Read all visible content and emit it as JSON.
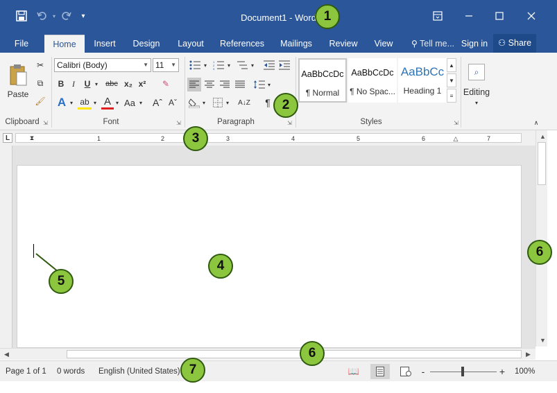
{
  "title": "Document1 - Word",
  "titlebar": {
    "save_icon": "save-icon",
    "undo_icon": "undo-icon",
    "redo_icon": "redo-icon",
    "qat_icon": "customize-quick-access-icon",
    "ribbon_display_icon": "ribbon-display-options-icon",
    "minimize_icon": "minimize-icon",
    "maximize_icon": "maximize-icon",
    "close_icon": "close-icon"
  },
  "tabs": [
    {
      "label": "File"
    },
    {
      "label": "Home"
    },
    {
      "label": "Insert"
    },
    {
      "label": "Design"
    },
    {
      "label": "Layout"
    },
    {
      "label": "References"
    },
    {
      "label": "Mailings"
    },
    {
      "label": "Review"
    },
    {
      "label": "View"
    }
  ],
  "tell_me": "Tell me...",
  "sign_in": "Sign in",
  "share": "Share",
  "ribbon": {
    "clipboard": {
      "paste": "Paste",
      "label": "Clipboard"
    },
    "font": {
      "name": "Calibri (Body)",
      "size": "11",
      "change_case": "Aa",
      "label": "Font"
    },
    "paragraph": {
      "label": "Paragraph"
    },
    "styles": {
      "items": [
        {
          "preview": "AaBbCcDc",
          "name": "¶ Normal"
        },
        {
          "preview": "AaBbCcDc",
          "name": "¶ No Spac..."
        },
        {
          "preview": "AaBbCc",
          "name": "Heading 1"
        }
      ],
      "label": "Styles"
    },
    "editing": {
      "label": "Editing"
    }
  },
  "ruler_numbers": [
    "1",
    "2",
    "3",
    "4",
    "5",
    "6",
    "7"
  ],
  "status": {
    "page": "Page 1 of 1",
    "words": "0 words",
    "language": "English (United States)",
    "zoom": "100%",
    "zoom_minus": "-",
    "zoom_plus": "+"
  },
  "callouts": [
    "1",
    "2",
    "3",
    "4",
    "5",
    "6",
    "6",
    "7"
  ],
  "colors": {
    "accent": "#2b579a",
    "callout": "#8cc63f"
  }
}
